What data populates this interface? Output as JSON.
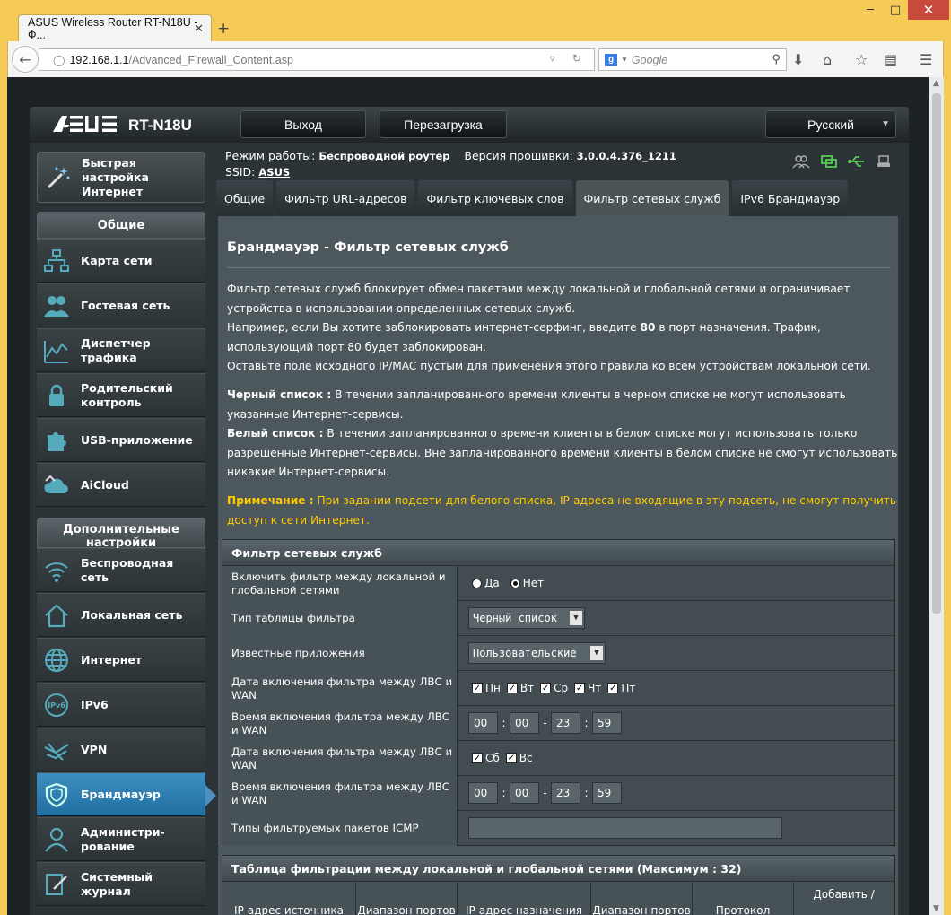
{
  "browser": {
    "tab_title": "ASUS Wireless Router RT-N18U - Ф...",
    "url_host": "192.168.1.1",
    "url_path": "/Advanced_Firewall_Content.asp",
    "search_placeholder": "Google"
  },
  "header": {
    "logo": "/ISUS",
    "model": "RT-N18U",
    "logout": "Выход",
    "reboot": "Перезагрузка",
    "language": "Русский"
  },
  "info": {
    "mode_label": "Режим работы:",
    "mode_value": "Беспроводной роутер",
    "fw_label": "Версия прошивки:",
    "fw_value": "3.0.0.4.376_1211",
    "ssid_label": "SSID:",
    "ssid_value": "ASUS"
  },
  "tabs": [
    "Общие",
    "Фильтр URL-адресов",
    "Фильтр ключевых слов",
    "Фильтр сетевых служб",
    "IPv6 Брандмауэр"
  ],
  "sidebar": {
    "quick": "Быстрая настройка Интернет",
    "general_title": "Общие",
    "general": [
      "Карта сети",
      "Гостевая сеть",
      "Диспетчер трафика",
      "Родительский контроль",
      "USB-приложение",
      "AiCloud"
    ],
    "advanced_title": "Дополнительные настройки",
    "advanced": [
      "Беспроводная сеть",
      "Локальная сеть",
      "Интернет",
      "IPv6",
      "VPN",
      "Брандмауэр",
      "Администри-рование",
      "Системный журнал"
    ]
  },
  "content": {
    "title": "Брандмауэр - Фильтр сетевых служб",
    "p1": "Фильтр сетевых служб блокирует обмен пакетами между локальной и глобальной сетями и ограничивает устройства в использовании определенных сетевых служб.",
    "p2a": "Например, если Вы хотите заблокировать интернет-серфинг, введите ",
    "p2b": "80",
    "p2c": " в порт назначения. Трафик, использующий порт 80 будет заблокирован.",
    "p3": "Оставьте поле исходного IP/MAC пустым для применения этого правила ко всем устройствам локальной сети.",
    "black_label": "Черный список :",
    "black_text": " В течении запланированного времени клиенты в черном списке не могут использовать указанные Интернет-сервисы.",
    "white_label": "Белый список :",
    "white_text": " В течении запланированного времени клиенты в белом списке могут использовать только разрешенные Интернет-сервисы. Вне запланированного времени клиенты в белом списке не смогут использовать никакие Интернет-сервисы.",
    "note_label": "Примечание :",
    "note_text": " При задании подсети для белого списка, IP-адреса не входящие в эту подсеть, не смогут получить доступ к сети Интернет."
  },
  "form": {
    "header": "Фильтр сетевых служб",
    "enable_label": "Включить фильтр между локальной и глобальной сетями",
    "yes": "Да",
    "no": "Нет",
    "type_label": "Тип таблицы фильтра",
    "type_value": "Черный список",
    "apps_label": "Известные приложения",
    "apps_value": "Пользовательские",
    "date1_label": "Дата включения фильтра между ЛВС и WAN",
    "days1": [
      "Пн",
      "Вт",
      "Ср",
      "Чт",
      "Пт"
    ],
    "time1_label": "Время включения фильтра между ЛВС и WAN",
    "time1": [
      "00",
      "00",
      "23",
      "59"
    ],
    "date2_label": "Дата включения фильтра между ЛВС и WAN",
    "days2": [
      "Сб",
      "Вс"
    ],
    "time2_label": "Время включения фильтра между ЛВС и WAN",
    "time2": [
      "00",
      "00",
      "23",
      "59"
    ],
    "icmp_label": "Типы фильтруемых пакетов ICMP"
  },
  "table": {
    "header": "Таблица фильтрации между локальной и глобальной сетями (Максимум : 32)",
    "columns": [
      "IP-адрес источника",
      "Диапазон портов",
      "IP-адрес назначения",
      "Диапазон портов",
      "Протокол",
      "Добавить /"
    ]
  }
}
